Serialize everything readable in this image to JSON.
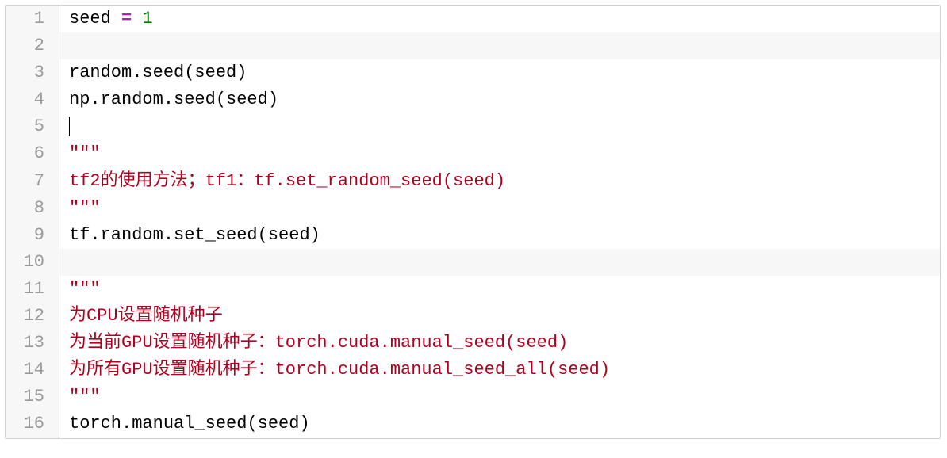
{
  "code": {
    "line_numbers": [
      "1",
      "2",
      "3",
      "4",
      "5",
      "6",
      "7",
      "8",
      "9",
      "10",
      "11",
      "12",
      "13",
      "14",
      "15",
      "16"
    ],
    "l1": {
      "a": "seed ",
      "op": "=",
      "b": " ",
      "num": "1"
    },
    "l2": "",
    "l3": "random.seed(seed)",
    "l4": "np.random.seed(seed)",
    "l5_cursor": true,
    "l6": "\"\"\"",
    "l7": "tf2的使用方法；tf1：tf.set_random_seed(seed)",
    "l8": "\"\"\"",
    "l9": "tf.random.set_seed(seed)",
    "l10": "",
    "l11": "\"\"\"",
    "l12": "为CPU设置随机种子",
    "l13": "为当前GPU设置随机种子：torch.cuda.manual_seed(seed)",
    "l14": "为所有GPU设置随机种子：torch.cuda.manual_seed_all(seed)",
    "l15": "\"\"\"",
    "l16": "torch.manual_seed(seed)"
  }
}
